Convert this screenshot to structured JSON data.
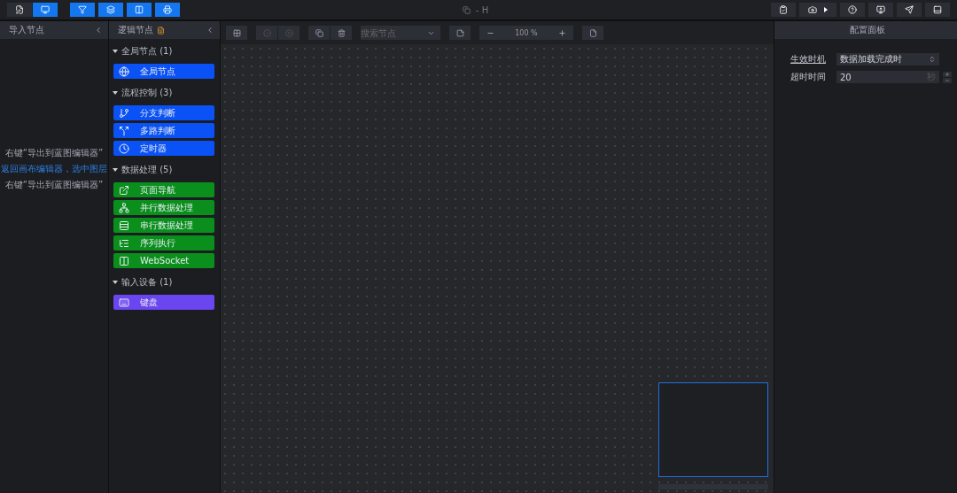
{
  "toolbar": {
    "modes": [
      {
        "selected": false
      },
      {
        "selected": true
      }
    ],
    "title": "- H"
  },
  "import_panel": {
    "title": "导入节点",
    "hints": [
      {
        "text": "右键“导出到蓝图编辑器”",
        "kind": "plain"
      },
      {
        "text": "返回画布编辑器，选中图层",
        "kind": "link"
      },
      {
        "text": "右键“导出到蓝图编辑器”",
        "kind": "plain"
      }
    ]
  },
  "logic_panel": {
    "title": "逻辑节点",
    "groups": [
      {
        "title": "全局节点 (1)",
        "expanded": true,
        "color": "#0a52f5",
        "items": [
          {
            "label": "全局节点",
            "kind": "globe"
          }
        ]
      },
      {
        "title": "流程控制 (3)",
        "expanded": true,
        "color": "#0a52f5",
        "items": [
          {
            "label": "分支判断",
            "kind": "branch"
          },
          {
            "label": "多路判断",
            "kind": "multi"
          },
          {
            "label": "定时器",
            "kind": "clock"
          }
        ]
      },
      {
        "title": "数据处理 (5)",
        "expanded": true,
        "color": "#0a8f1c",
        "items": [
          {
            "label": "页面导航",
            "kind": "link"
          },
          {
            "label": "并行数据处理",
            "kind": "tree"
          },
          {
            "label": "串行数据处理",
            "kind": "rows"
          },
          {
            "label": "序列执行",
            "kind": "list"
          },
          {
            "label": "WebSocket",
            "kind": "socket"
          }
        ]
      },
      {
        "title": "输入设备 (1)",
        "expanded": true,
        "color": "#6a45f0",
        "items": [
          {
            "label": "键盘",
            "kind": "keyboard"
          }
        ]
      }
    ]
  },
  "canvas_toolbar": {
    "search": {
      "placeholder": "搜索节点"
    },
    "zoom": "100 %"
  },
  "config_panel": {
    "title": "配置面板",
    "fields": [
      {
        "label": "生效时机",
        "kind": "select",
        "value": "数据加载完成时"
      },
      {
        "label": "超时时间",
        "kind": "number",
        "value": "20",
        "unit": "秒"
      }
    ]
  }
}
